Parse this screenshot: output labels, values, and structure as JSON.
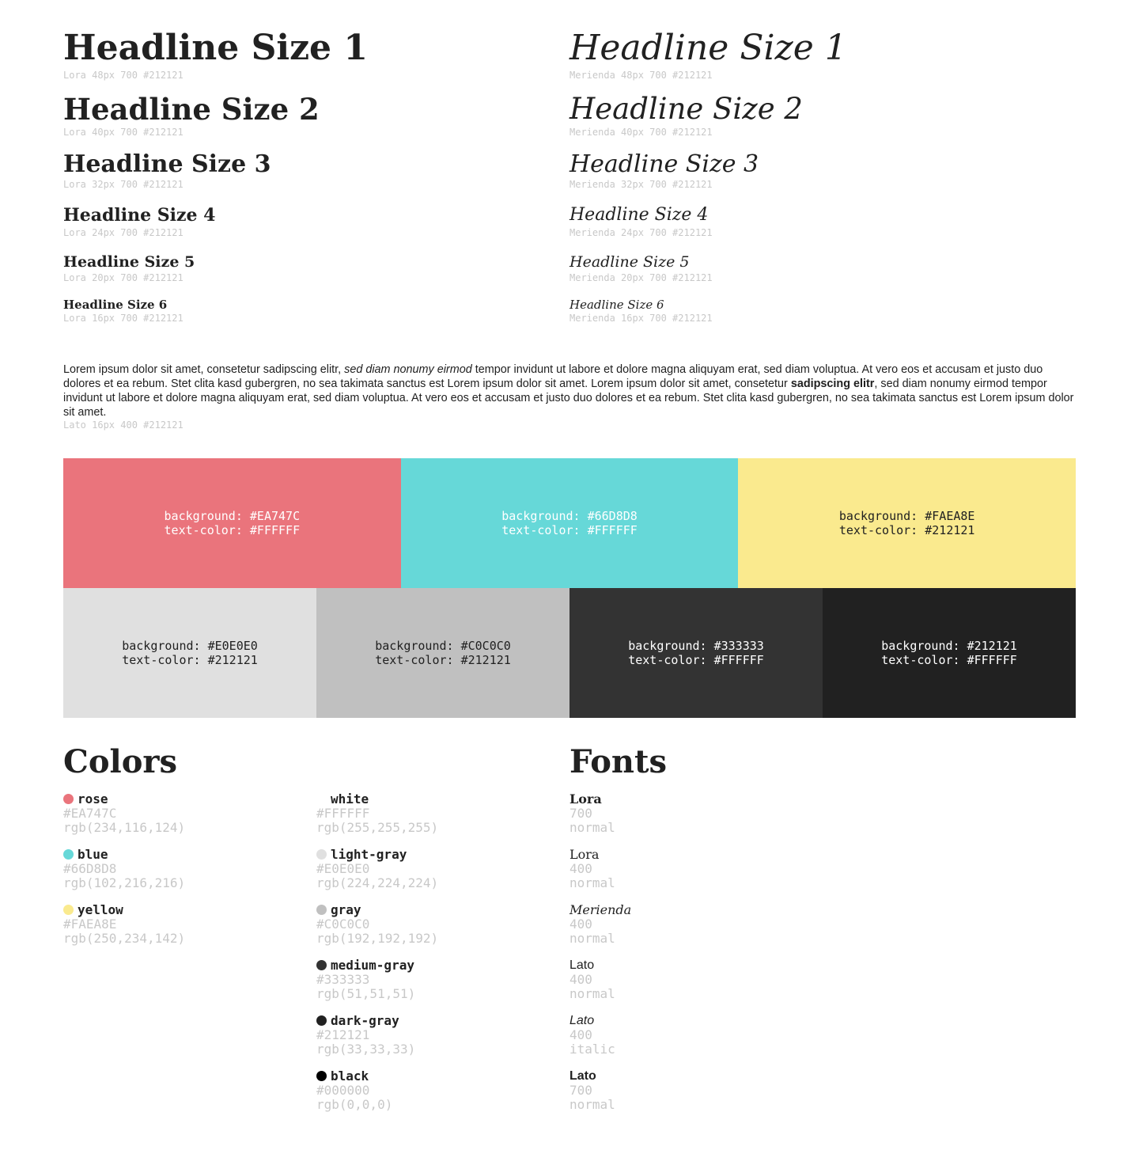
{
  "headlines_left": [
    {
      "text": "Headline Size 1",
      "spec": "Lora 48px 700 #212121"
    },
    {
      "text": "Headline Size 2",
      "spec": "Lora 40px 700 #212121"
    },
    {
      "text": "Headline Size 3",
      "spec": "Lora 32px 700 #212121"
    },
    {
      "text": "Headline Size 4",
      "spec": "Lora 24px 700 #212121"
    },
    {
      "text": "Headline Size 5",
      "spec": "Lora 20px 700 #212121"
    },
    {
      "text": "Headline Size 6",
      "spec": "Lora 16px 700 #212121"
    }
  ],
  "headlines_right": [
    {
      "text": "Headline Size 1",
      "spec": "Merienda 48px 700 #212121"
    },
    {
      "text": "Headline Size 2",
      "spec": "Merienda 40px 700 #212121"
    },
    {
      "text": "Headline Size 3",
      "spec": "Merienda 32px 700 #212121"
    },
    {
      "text": "Headline Size 4",
      "spec": "Merienda 24px 700 #212121"
    },
    {
      "text": "Headline Size 5",
      "spec": "Merienda 20px 700 #212121"
    },
    {
      "text": "Headline Size 6",
      "spec": "Merienda 16px 700 #212121"
    }
  ],
  "body_text": {
    "part1": "Lorem ipsum dolor sit amet, consetetur sadipscing elitr, ",
    "italic": "sed diam nonumy eirmod",
    "part2": " tempor invidunt ut labore et dolore magna aliquyam erat, sed diam voluptua. At vero eos et accusam et justo duo dolores et ea rebum. Stet clita kasd gubergren, no sea takimata sanctus est Lorem ipsum dolor sit amet. Lorem ipsum dolor sit amet, consetetur ",
    "bold": "sadipscing elitr",
    "part3": ", sed diam nonumy eirmod tempor invidunt ut labore et dolore magna aliquyam erat, sed diam voluptua. At vero eos et accusam et justo duo dolores et ea rebum. Stet clita kasd gubergren, no sea takimata sanctus est Lorem ipsum dolor sit amet.",
    "spec": "Lato 16px 400 #212121"
  },
  "swatches_row1": [
    {
      "bg_label": "background: #EA747C",
      "fg_label": "text-color: #FFFFFF",
      "bg": "#EA747C",
      "fg": "#FFFFFF"
    },
    {
      "bg_label": "background: #66D8D8",
      "fg_label": "text-color: #FFFFFF",
      "bg": "#66D8D8",
      "fg": "#FFFFFF"
    },
    {
      "bg_label": "background: #FAEA8E",
      "fg_label": "text-color: #212121",
      "bg": "#FAEA8E",
      "fg": "#212121"
    }
  ],
  "swatches_row2": [
    {
      "bg_label": "background: #E0E0E0",
      "fg_label": "text-color: #212121",
      "bg": "#E0E0E0",
      "fg": "#212121"
    },
    {
      "bg_label": "background: #C0C0C0",
      "fg_label": "text-color: #212121",
      "bg": "#C0C0C0",
      "fg": "#212121"
    },
    {
      "bg_label": "background: #333333",
      "fg_label": "text-color: #FFFFFF",
      "bg": "#333333",
      "fg": "#FFFFFF"
    },
    {
      "bg_label": "background: #212121",
      "fg_label": "text-color: #FFFFFF",
      "bg": "#212121",
      "fg": "#FFFFFF"
    }
  ],
  "colors_section": {
    "title": "Colors",
    "col1": [
      {
        "name": "rose",
        "hex": "#EA747C",
        "rgb": "rgb(234,116,124)",
        "dot": "#EA747C"
      },
      {
        "name": "blue",
        "hex": "#66D8D8",
        "rgb": "rgb(102,216,216)",
        "dot": "#66D8D8"
      },
      {
        "name": "yellow",
        "hex": "#FAEA8E",
        "rgb": "rgb(250,234,142)",
        "dot": "#FAEA8E"
      }
    ],
    "col2": [
      {
        "name": "white",
        "hex": "#FFFFFF",
        "rgb": "rgb(255,255,255)",
        "dot": "#FFFFFF"
      },
      {
        "name": "light-gray",
        "hex": "#E0E0E0",
        "rgb": "rgb(224,224,224)",
        "dot": "#E0E0E0"
      },
      {
        "name": "gray",
        "hex": "#C0C0C0",
        "rgb": "rgb(192,192,192)",
        "dot": "#C0C0C0"
      },
      {
        "name": "medium-gray",
        "hex": "#333333",
        "rgb": "rgb(51,51,51)",
        "dot": "#333333"
      },
      {
        "name": "dark-gray",
        "hex": "#212121",
        "rgb": "rgb(33,33,33)",
        "dot": "#212121"
      },
      {
        "name": "black",
        "hex": "#000000",
        "rgb": "rgb(0,0,0)",
        "dot": "#000000"
      }
    ]
  },
  "fonts_section": {
    "title": "Fonts",
    "items": [
      {
        "name": "Lora",
        "weight": "700",
        "style": "normal"
      },
      {
        "name": "Lora",
        "weight": "400",
        "style": "normal"
      },
      {
        "name": "Merienda",
        "weight": "400",
        "style": "normal"
      },
      {
        "name": "Lato",
        "weight": "400",
        "style": "normal"
      },
      {
        "name": "Lato",
        "weight": "400",
        "style": "italic"
      },
      {
        "name": "Lato",
        "weight": "700",
        "style": "normal"
      }
    ]
  }
}
